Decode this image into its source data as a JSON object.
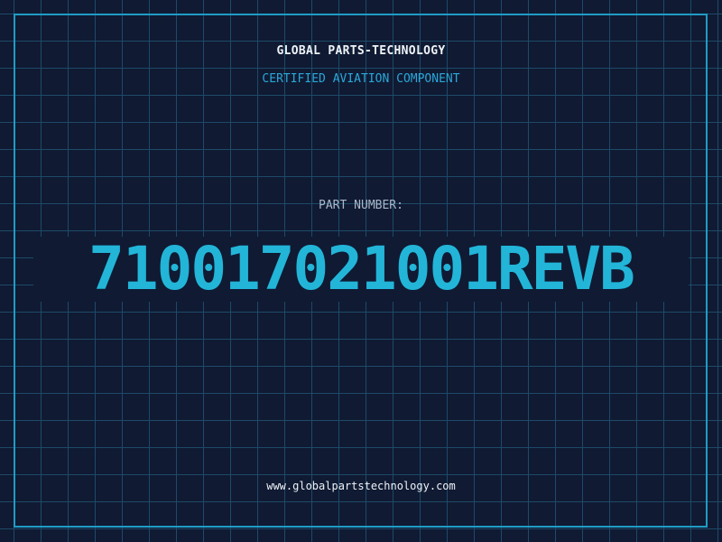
{
  "header": {
    "company": "GLOBAL PARTS-TECHNOLOGY",
    "tagline": "CERTIFIED AVIATION COMPONENT"
  },
  "part": {
    "label": "PART NUMBER:",
    "number": "71001702100 1REVB"
  },
  "footer": {
    "url": "www.globalpartstechnology.com"
  },
  "colors": {
    "background": "#101a33",
    "grid": "#1d4a68",
    "frame": "#1f9cc4",
    "accent": "#22b5d8"
  }
}
